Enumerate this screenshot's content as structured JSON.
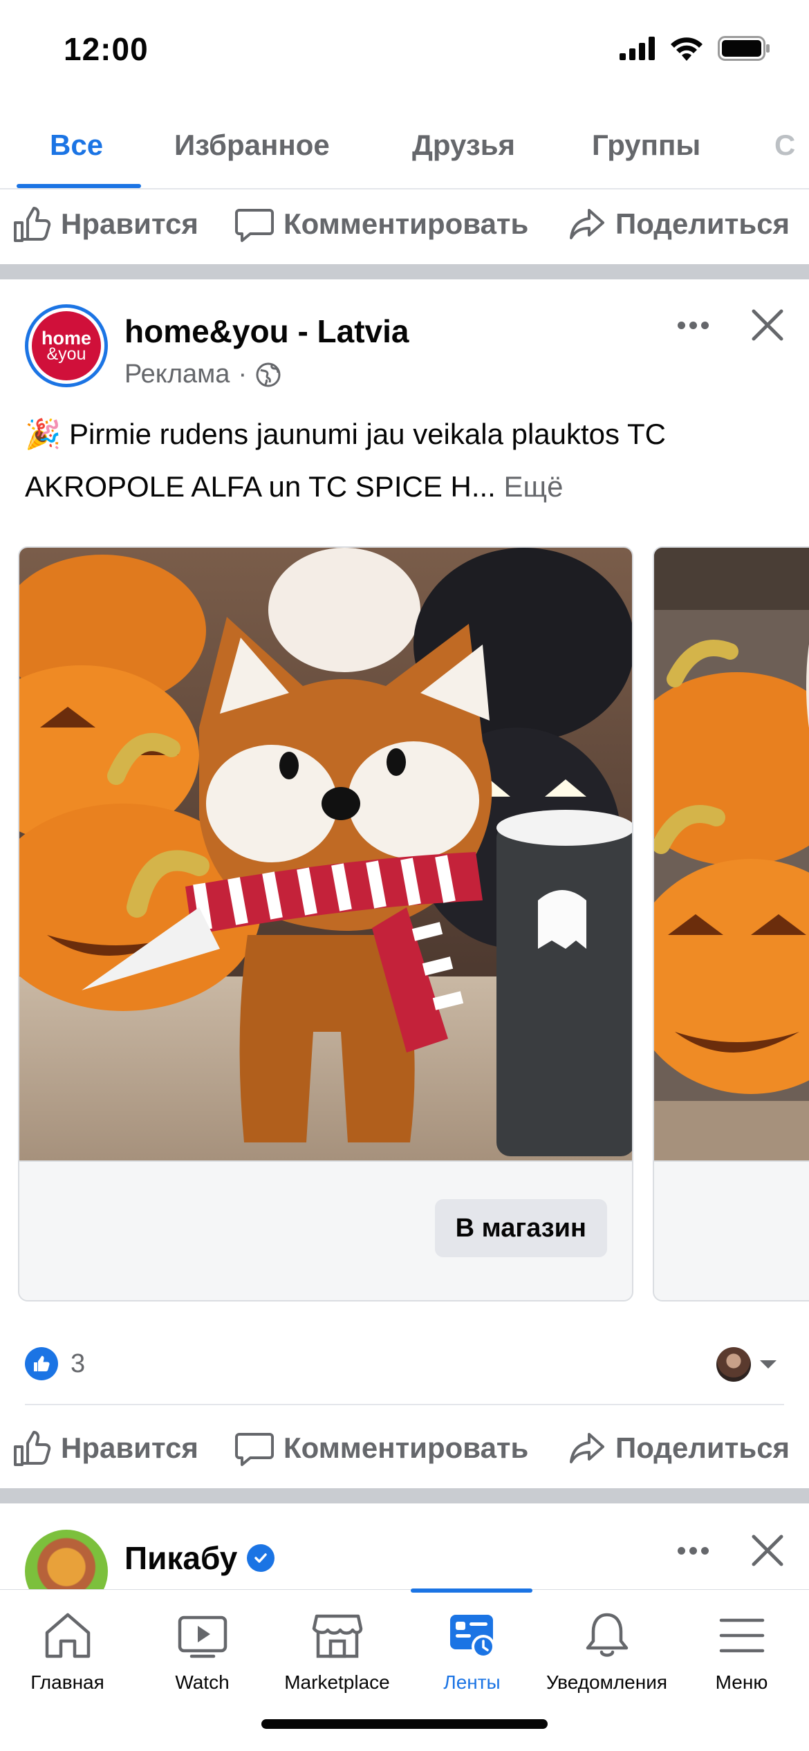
{
  "status_bar": {
    "time": "12:00"
  },
  "top_tabs": [
    {
      "label": "Все",
      "active": true
    },
    {
      "label": "Избранное",
      "active": false
    },
    {
      "label": "Друзья",
      "active": false
    },
    {
      "label": "Группы",
      "active": false
    },
    {
      "label": "С",
      "active": false
    }
  ],
  "actions": {
    "like": "Нравится",
    "comment": "Комментировать",
    "share": "Поделиться"
  },
  "post": {
    "page_name": "home&you - Latvia",
    "avatar_text_line1": "home",
    "avatar_text_line2": "&you",
    "sponsored": "Реклама",
    "separator": "·",
    "emoji": "🎉",
    "text": "Pirmie rudens jaunumi jau veikala plauktos TC AKROPOLE ALFA un TC SPICE H...",
    "see_more": "Ещё",
    "cta_label": "В магазин",
    "reaction_count": "3"
  },
  "next_post": {
    "page_name": "Пикабу"
  },
  "bottom_nav": [
    {
      "label": "Главная",
      "icon": "home-icon",
      "active": false
    },
    {
      "label": "Watch",
      "icon": "watch-icon",
      "active": false
    },
    {
      "label": "Marketplace",
      "icon": "marketplace-icon",
      "active": false
    },
    {
      "label": "Ленты",
      "icon": "feeds-icon",
      "active": true
    },
    {
      "label": "Уведомления",
      "icon": "bell-icon",
      "active": false
    },
    {
      "label": "Меню",
      "icon": "menu-icon",
      "active": false
    }
  ],
  "colors": {
    "accent": "#1b74e4",
    "secondary_text": "#65676b",
    "separator": "#c9ccd1",
    "brand_red": "#d0103a"
  }
}
